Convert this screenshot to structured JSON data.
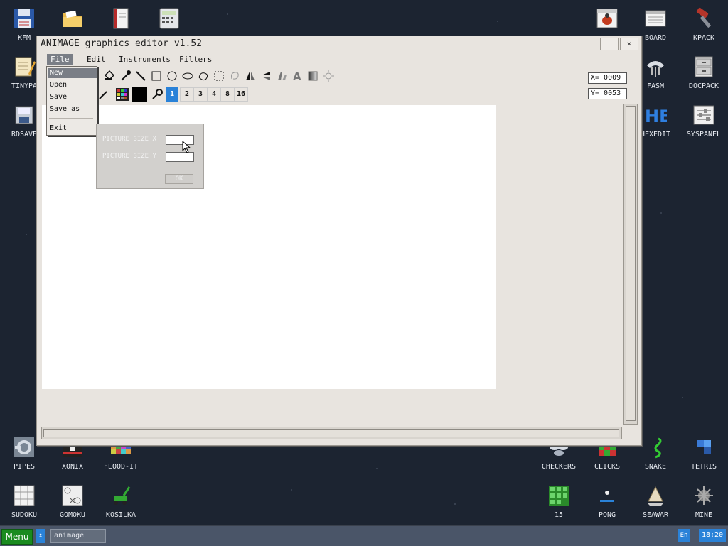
{
  "desktop": {
    "icons": [
      {
        "label": "KFM",
        "icon": "floppy-disk-icon"
      },
      {
        "label": "",
        "icon": "folder-icon"
      },
      {
        "label": "",
        "icon": "notebook-icon"
      },
      {
        "label": "",
        "icon": "calculator-icon"
      },
      {
        "label": "TINYPA",
        "icon": "notepad-icon"
      },
      {
        "label": "RDSAVE",
        "icon": "save-icon"
      },
      {
        "label": "",
        "icon": "bug-icon"
      },
      {
        "label": "BOARD",
        "icon": "board-icon"
      },
      {
        "label": "KPACK",
        "icon": "hammer-icon"
      },
      {
        "label": "FASM",
        "icon": "fasm-icon"
      },
      {
        "label": "DOCPACK",
        "icon": "drawer-icon"
      },
      {
        "label": "HEXEDIT",
        "icon": "hexedit-icon"
      },
      {
        "label": "SYSPANEL",
        "icon": "sliders-icon"
      },
      {
        "label": "PIPES",
        "icon": "pipes-icon"
      },
      {
        "label": "XONIX",
        "icon": "xonix-icon"
      },
      {
        "label": "FLOOD-IT",
        "icon": "flood-it-icon"
      },
      {
        "label": "CHECKERS",
        "icon": "checkers-icon"
      },
      {
        "label": "CLICKS",
        "icon": "clicks-icon"
      },
      {
        "label": "SNAKE",
        "icon": "snake-icon"
      },
      {
        "label": "TETRIS",
        "icon": "tetris-icon"
      },
      {
        "label": "SUDOKU",
        "icon": "sudoku-icon"
      },
      {
        "label": "GOMOKU",
        "icon": "gomoku-icon"
      },
      {
        "label": "KOSILKA",
        "icon": "lawnmower-icon"
      },
      {
        "label": "15",
        "icon": "fifteen-icon"
      },
      {
        "label": "PONG",
        "icon": "pong-icon"
      },
      {
        "label": "SEAWAR",
        "icon": "seawar-icon"
      },
      {
        "label": "MINE",
        "icon": "mine-icon"
      }
    ]
  },
  "window": {
    "title": "ANIMAGE graphics editor v1.52",
    "minimize": "_",
    "close": "×",
    "menu": [
      "File",
      "Edit",
      "Instruments",
      "Filters"
    ],
    "file_menu": [
      "New",
      "Open",
      "Save",
      "Save as",
      "Exit"
    ],
    "line_widths": [
      "1",
      "2",
      "3",
      "4",
      "8",
      "16"
    ],
    "coords": {
      "x": "X= 0009",
      "y": "Y= 0053"
    },
    "dialog": {
      "size_x_label": "PICTURE SIZE X",
      "size_y_label": "PICTURE SIZE Y",
      "size_x_value": "",
      "size_y_value": "",
      "ok": "OK"
    }
  },
  "colors": {
    "accent": "#2a82d8",
    "menu_green": "#1a8b1f",
    "desktop": "#1c2431",
    "window": "#e8e4df"
  },
  "taskbar": {
    "menu": "Menu",
    "arrow": "↕",
    "task": "animage",
    "lang": "En",
    "clock": "18:20"
  }
}
